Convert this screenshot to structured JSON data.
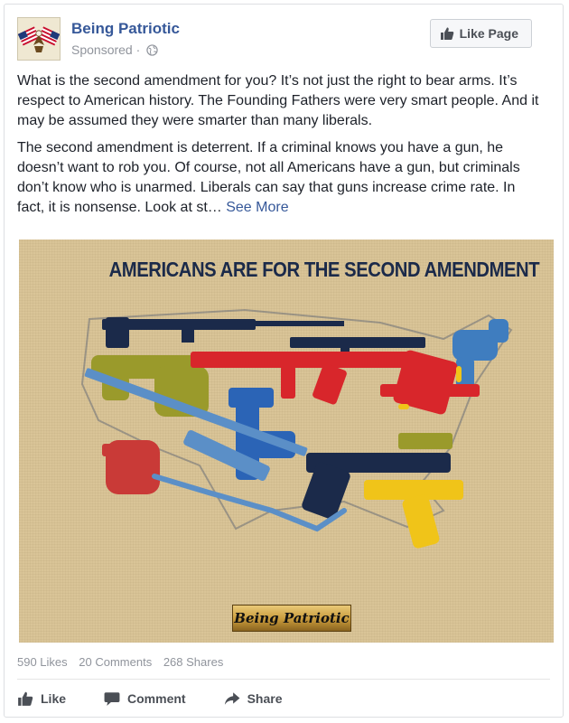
{
  "post": {
    "page_name": "Being Patriotic",
    "sponsored": "Sponsored ·",
    "like_page_label": "Like Page",
    "paragraphs": [
      "What is the second amendment for you? It’s not just the right to bear arms. It’s respect to American history. The Founding Fathers were very smart people. And it may be assumed they were smarter than many liberals.",
      "The second amendment is deterrent. If a criminal knows you have a gun, he doesn’t want to rob you. Of course, not all Americans have a gun, but criminals don’t know who is unarmed. Liberals can say that guns increase crime rate. In fact, it is nonsense. Look at st…"
    ],
    "see_more_label": "See More",
    "image": {
      "title": "AMERICANS ARE FOR THE SECOND AMENDMENT",
      "banner_text": "Being Patriotic",
      "colors": {
        "background": "#d9c497",
        "navy": "#1b2a4a",
        "red": "#d8262b",
        "blue": "#2b64b6",
        "olive": "#9a9a2b",
        "yellow": "#f0c419",
        "light_blue": "#5b8fc7",
        "dark_red": "#9c1c1c"
      }
    },
    "stats": {
      "likes": "590 Likes",
      "comments": "20 Comments",
      "shares": "268 Shares"
    },
    "actions": {
      "like_label": "Like",
      "comment_label": "Comment",
      "share_label": "Share"
    }
  },
  "icons": {
    "avatar": "american-flags-eagle-icon",
    "privacy": "globe-icon",
    "like_page": "thumbs-up-icon",
    "like": "thumbs-up-icon",
    "comment": "comment-bubble-icon",
    "share": "share-arrow-icon"
  }
}
